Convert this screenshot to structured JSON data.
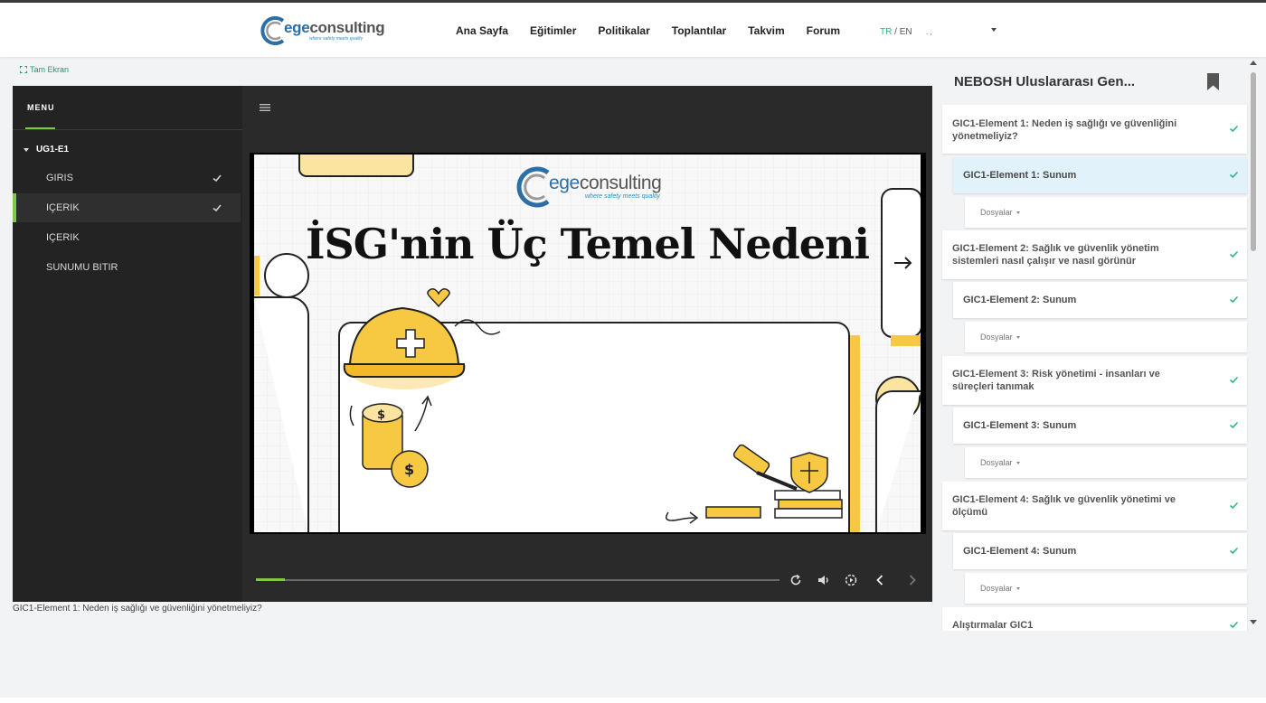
{
  "header": {
    "logo": {
      "prefix": "ege",
      "suffix": "consulting",
      "tagline": "where safety meets quality"
    },
    "nav": [
      "Ana Sayfa",
      "Eğitimler",
      "Politikalar",
      "Toplantılar",
      "Takvim",
      "Forum"
    ],
    "lang_tr": "TR",
    "lang_sep": " / ",
    "lang_en": "EN",
    "user_menu_text": ". ,"
  },
  "fullscreen_label": "Tam Ekran",
  "player": {
    "menu_title": "MENU",
    "group": "UG1-E1",
    "items": [
      {
        "label": "GIRIS",
        "done": true,
        "active": false
      },
      {
        "label": "IÇERIK",
        "done": true,
        "active": true
      },
      {
        "label": "IÇERIK",
        "done": false,
        "active": false
      },
      {
        "label": "SUNUMU BITIR",
        "done": false,
        "active": false
      }
    ],
    "slide": {
      "title": "İSG'nin Üç Temel Nedeni",
      "logo_prefix": "ege",
      "logo_suffix": "consulting",
      "logo_tagline": "where safety meets quality"
    },
    "progress": 0.055,
    "icons": [
      "replay-icon",
      "volume-icon",
      "speed-icon",
      "prev-icon",
      "next-icon"
    ]
  },
  "caption": "GIC1-Element 1: Neden iş sağlığı ve güvenliğini yönetmeliyiz?",
  "panel": {
    "title": "NEBOSH Uluslararası Gen...",
    "elements": [
      {
        "title": "GIC1-Element 1: Neden iş sağlığı ve güvenliğini yönetmeliyiz?",
        "sunum": "GIC1-Element 1: Sunum",
        "files": "Dosyalar",
        "active": true
      },
      {
        "title": "GIC1-Element 2: Sağlık ve güvenlik yönetim sistemleri nasıl çalışır ve nasıl görünür",
        "sunum": "GIC1-Element 2: Sunum",
        "files": "Dosyalar",
        "active": false
      },
      {
        "title": "GIC1-Element 3: Risk yönetimi - insanları ve süreçleri tanımak",
        "sunum": "GIC1-Element 3: Sunum",
        "files": "Dosyalar",
        "active": false
      },
      {
        "title": "GIC1-Element 4: Sağlık ve güvenlik yönetimi ve ölçümü",
        "sunum": "GIC1-Element 4: Sunum",
        "files": "Dosyalar",
        "active": false
      }
    ],
    "exercises": "Alıştırmalar GIC1"
  },
  "colors": {
    "accent_green": "#7ec84b",
    "check_green": "#2bb58a",
    "active_row": "#e1f2fb",
    "player_bg": "#2a2a2a"
  }
}
